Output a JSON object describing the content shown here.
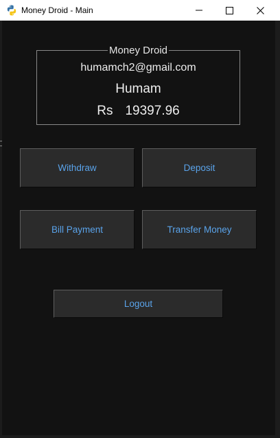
{
  "window": {
    "title": "Money Droid - Main",
    "icon": "python-icon",
    "controls": {
      "minimize": "minimize-icon",
      "maximize": "maximize-icon",
      "close": "close-icon"
    }
  },
  "account": {
    "frame_label": "Money Droid",
    "email": "humamch2@gmail.com",
    "name": "Humam",
    "currency": "Rs",
    "balance": "19397.96"
  },
  "actions": {
    "withdraw_label": "Withdraw",
    "deposit_label": "Deposit",
    "bill_payment_label": "Bill Payment",
    "transfer_money_label": "Transfer Money",
    "logout_label": "Logout"
  },
  "colors": {
    "background": "#121212",
    "button_face": "#2b2b2b",
    "button_text": "#5aa3ea",
    "label_text": "#eeeeee",
    "frame_border": "#8a8a8a",
    "titlebar": "#ffffff"
  }
}
